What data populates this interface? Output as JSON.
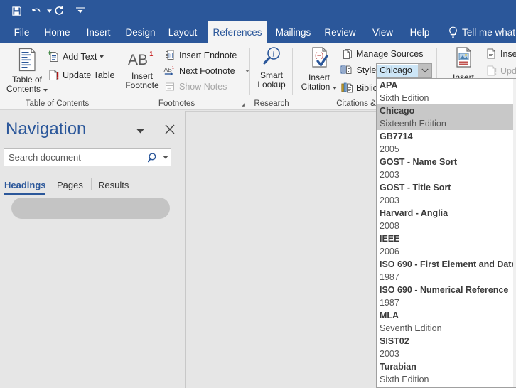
{
  "quick_access": {
    "buttons": [
      {
        "name": "save-button",
        "icon": "save-icon",
        "title": "Save"
      },
      {
        "name": "undo-button",
        "icon": "undo-icon",
        "title": "Undo"
      },
      {
        "name": "redo-button",
        "icon": "redo-icon",
        "title": "Redo"
      },
      {
        "name": "customize-qat-button",
        "icon": "chevron-down-icon",
        "title": "Customize Quick Access Toolbar"
      }
    ]
  },
  "ribbon_tabs": [
    {
      "label": "File",
      "active": false
    },
    {
      "label": "Home",
      "active": false
    },
    {
      "label": "Insert",
      "active": false
    },
    {
      "label": "Design",
      "active": false
    },
    {
      "label": "Layout",
      "active": false
    },
    {
      "label": "References",
      "active": true
    },
    {
      "label": "Mailings",
      "active": false
    },
    {
      "label": "Review",
      "active": false
    },
    {
      "label": "View",
      "active": false
    },
    {
      "label": "Help",
      "active": false
    }
  ],
  "tell_me": {
    "label": "Tell me what",
    "icon": "lightbulb-icon"
  },
  "ribbon": {
    "groups": [
      {
        "name": "table-of-contents",
        "label": "Table of Contents",
        "big_button": {
          "line1": "Table of",
          "line2": "Contents",
          "has_caret": true,
          "icon": "table-of-contents-icon"
        },
        "small_buttons": [
          {
            "label": "Add Text",
            "has_caret": true,
            "icon": "add-text-icon",
            "disabled": false
          },
          {
            "label": "Update Table",
            "has_caret": false,
            "icon": "update-table-icon",
            "disabled": false
          }
        ]
      },
      {
        "name": "footnotes",
        "label": "Footnotes",
        "big_button": {
          "line1": "Insert",
          "line2": "Footnote",
          "has_caret": false,
          "icon": "insert-footnote-icon",
          "glyph": "AB"
        },
        "small_buttons": [
          {
            "label": "Insert Endnote",
            "has_caret": false,
            "icon": "insert-endnote-icon",
            "disabled": false
          },
          {
            "label": "Next Footnote",
            "has_caret": true,
            "icon": "next-footnote-icon",
            "disabled": false
          },
          {
            "label": "Show Notes",
            "has_caret": false,
            "icon": "show-notes-icon",
            "disabled": true
          }
        ],
        "has_dialog_launcher": true
      },
      {
        "name": "research",
        "label": "Research",
        "big_button": {
          "line1": "Smart",
          "line2": "Lookup",
          "has_caret": false,
          "icon": "smart-lookup-icon"
        }
      },
      {
        "name": "citations-and-bibliography",
        "label": "Citations & Bibli",
        "big_button": {
          "line1": "Insert",
          "line2": "Citation",
          "has_caret": true,
          "icon": "insert-citation-icon"
        },
        "small_buttons": [
          {
            "label": "Manage Sources",
            "has_caret": false,
            "icon": "manage-sources-icon",
            "disabled": false
          },
          {
            "label": "Bibliog",
            "has_caret": false,
            "icon": "bibliography-icon",
            "disabled": false
          }
        ],
        "style_row": {
          "label": "Style:",
          "icon": "style-icon",
          "value": "Chicago",
          "dropdown_icon": "chevron-down-icon"
        }
      },
      {
        "name": "captions",
        "label": "",
        "big_button": {
          "line1": "Insert",
          "line2": "",
          "has_caret": false,
          "icon": "insert-caption-icon"
        },
        "small_buttons": [
          {
            "label": "Insert Ta",
            "has_caret": false,
            "icon": "insert-table-of-figures-icon",
            "disabled": false
          },
          {
            "label": "Update",
            "has_caret": false,
            "icon": "update-table-icon",
            "disabled": true
          }
        ]
      }
    ]
  },
  "style_dropdown": {
    "open": true,
    "items": [
      {
        "name": "APA",
        "sub": "Sixth Edition",
        "selected": false
      },
      {
        "name": "Chicago",
        "sub": "Sixteenth Edition",
        "selected": true
      },
      {
        "name": "GB7714",
        "sub": "2005",
        "selected": false
      },
      {
        "name": "GOST - Name Sort",
        "sub": "2003",
        "selected": false
      },
      {
        "name": "GOST - Title Sort",
        "sub": "2003",
        "selected": false
      },
      {
        "name": "Harvard - Anglia",
        "sub": "2008",
        "selected": false
      },
      {
        "name": "IEEE",
        "sub": "2006",
        "selected": false
      },
      {
        "name": "ISO 690 - First Element and Date",
        "sub": "1987",
        "selected": false
      },
      {
        "name": "ISO 690 - Numerical Reference",
        "sub": "1987",
        "selected": false
      },
      {
        "name": "MLA",
        "sub": "Seventh Edition",
        "selected": false
      },
      {
        "name": "SIST02",
        "sub": "2003",
        "selected": false
      },
      {
        "name": "Turabian",
        "sub": "Sixth Edition",
        "selected": false
      }
    ]
  },
  "navigation": {
    "title": "Navigation",
    "menu_icon": "chevron-down-icon",
    "close_icon": "close-icon",
    "search": {
      "placeholder": "Search document",
      "value": "",
      "search_icon": "search-icon",
      "options_icon": "chevron-down-icon"
    },
    "tabs": [
      {
        "label": "Headings",
        "selected": true
      },
      {
        "label": "Pages",
        "selected": false
      },
      {
        "label": "Results",
        "selected": false
      }
    ],
    "heading_items": [
      {
        "label": "",
        "redacted": true
      }
    ]
  },
  "colors": {
    "ribbon_blue": "#2b579a",
    "ribbon_bg": "#f4f4f4",
    "document_bg": "#e6e6e6",
    "selection_highlight": "#cde6f7",
    "dropdown_selected": "#c8c8c8"
  }
}
